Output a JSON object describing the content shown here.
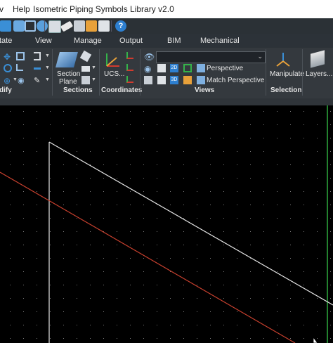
{
  "menubar": {
    "items": [
      "v",
      "Help"
    ],
    "title": "Isometric Piping Symbols Library v2.0"
  },
  "tabs": [
    "tate",
    "View",
    "Manage",
    "Output",
    "BIM",
    "Mechanical"
  ],
  "ribbon": {
    "sections_button": {
      "line1": "Section",
      "line2": "Plane"
    },
    "ucs_button": "UCS...",
    "views": {
      "dropdown_value": "",
      "perspective": "Perspective",
      "match_perspective": "Match Perspective",
      "view_2d": "2D",
      "view_3d": "3D"
    },
    "manipulate_button": "Manipulate",
    "layers_button": "Layers...",
    "panel_labels": [
      "dify",
      "Sections",
      "Coordinates",
      "Views",
      "Selection"
    ]
  },
  "colors": {
    "accent_blue": "#3a8fd6",
    "accent_orange": "#e8a13a",
    "accent_red": "#d23b2e",
    "accent_green": "#35b34a",
    "viewport_bg": "#000000",
    "white_line": "#e6e6e6",
    "red_line": "#c8402e",
    "green_axis": "#2fae3f",
    "grid_dot": "#7a7a7a"
  },
  "icons": {
    "qat": [
      "layers-icon",
      "cube-icon",
      "cube-outline-icon",
      "globe-icon",
      "table-icon",
      "eraser-icon",
      "list-icon",
      "image-icon",
      "help-icon"
    ],
    "modify": [
      "move-icon",
      "rotate-icon",
      "copy-icon",
      "mirror-icon",
      "stretch-icon",
      "scale-icon",
      "explode-icon",
      "fillet-icon",
      "trim-icon"
    ],
    "views": [
      "eye-icon",
      "camera-icon",
      "view-2d-icon",
      "view-3d-icon",
      "perspective-icon",
      "match-perspective-icon"
    ]
  }
}
